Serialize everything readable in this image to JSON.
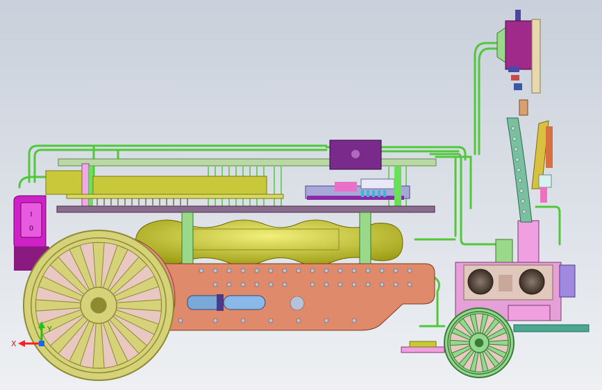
{
  "viewport": {
    "background_top": "#c9d0db",
    "background_bottom": "#eef0f3"
  },
  "triad": {
    "x_label": "X",
    "y_label": "Y",
    "x_color": "#ff2020",
    "y_color": "#20c020",
    "z_color": "#2060ff"
  },
  "power_switch": {
    "symbol": "I\n0",
    "color": "#d020c8"
  },
  "colors": {
    "wire": "#4fc83a",
    "wire_dark": "#2e8f24",
    "deck": "#8a6c8f",
    "pcb_yellow": "#c8c83a",
    "battery": "#c8c81e",
    "chassis": "#e08a6c",
    "wheel": "#d6d27a",
    "wheel_dark": "#8d8a30",
    "gear": "#e5948a",
    "small_wheel": "#93d88c",
    "sensor_body": "#e5a0d8",
    "sensor_eye": "#5a4a40",
    "purple_block": "#7a2a8a",
    "motor": "#9aa8d8",
    "violet_cap": "#a08ae0",
    "teal_plate": "#4aa890",
    "pink_post": "#f0a0e0"
  }
}
